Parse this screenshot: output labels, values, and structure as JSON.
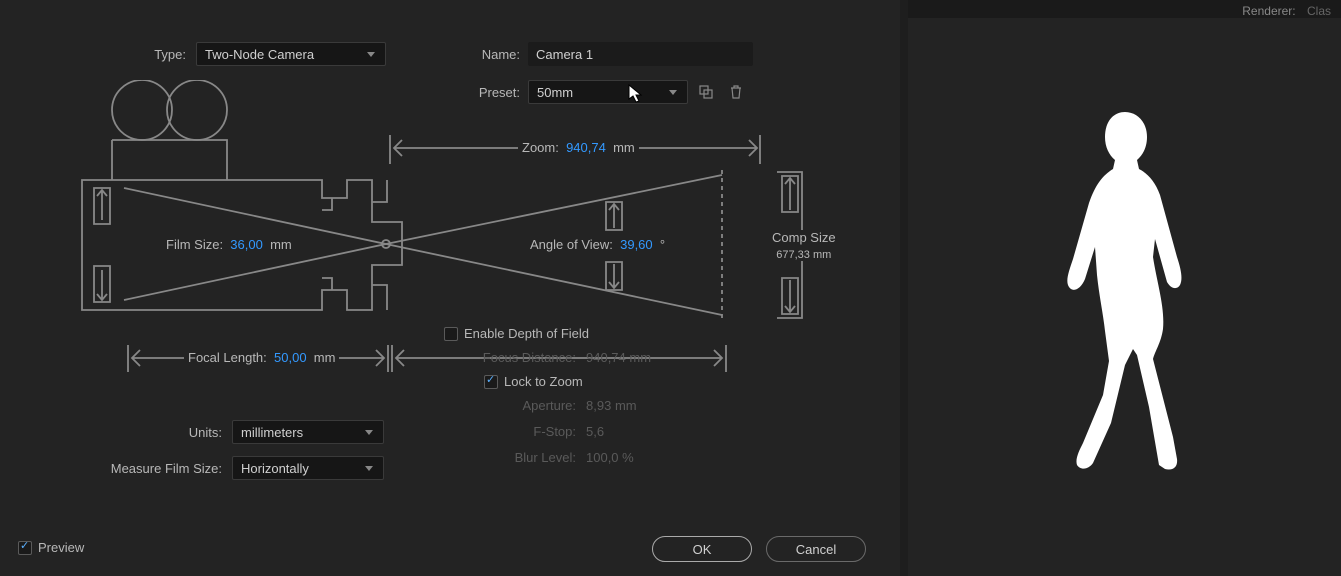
{
  "header": {
    "renderer_label": "Renderer:",
    "renderer_value": "Clas"
  },
  "form": {
    "type_label": "Type:",
    "type_value": "Two-Node Camera",
    "name_label": "Name:",
    "name_value": "Camera 1",
    "preset_label": "Preset:",
    "preset_value": "50mm",
    "units_label": "Units:",
    "units_value": "millimeters",
    "measure_label": "Measure Film Size:",
    "measure_value": "Horizontally"
  },
  "diagram": {
    "zoom_label": "Zoom:",
    "zoom_value": "940,74",
    "zoom_unit": "mm",
    "film_label": "Film Size:",
    "film_value": "36,00",
    "film_unit": "mm",
    "angle_label": "Angle of View:",
    "angle_value": "39,60",
    "angle_unit": "°",
    "comp_label": "Comp Size",
    "comp_value": "677,33 mm",
    "focal_label": "Focal Length:",
    "focal_value": "50,00",
    "focal_unit": "mm",
    "enable_dof": "Enable Depth of Field",
    "focus_dist_label": "Focus Distance:",
    "focus_dist_value": "940,74",
    "focus_dist_unit": "mm",
    "lock_zoom": "Lock to Zoom",
    "aperture_label": "Aperture:",
    "aperture_value": "8,93",
    "aperture_unit": "mm",
    "fstop_label": "F-Stop:",
    "fstop_value": "5,6",
    "blur_label": "Blur Level:",
    "blur_value": "100,0",
    "blur_unit": "%"
  },
  "footer": {
    "preview_label": "Preview",
    "ok": "OK",
    "cancel": "Cancel"
  }
}
